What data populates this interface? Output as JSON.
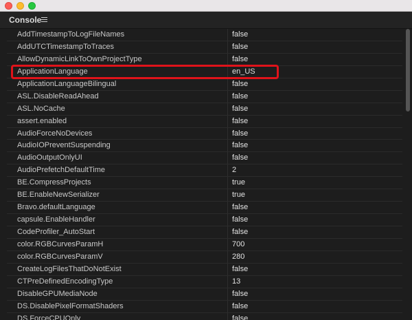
{
  "panel": {
    "title": "Console",
    "menu_icon": "hamburger-menu-icon"
  },
  "rows": [
    {
      "key": "AddTimestampToLogFileNames",
      "value": "false"
    },
    {
      "key": "AddUTCTimestampToTraces",
      "value": "false"
    },
    {
      "key": "AllowDynamicLinkToOwnProjectType",
      "value": "false"
    },
    {
      "key": "ApplicationLanguage",
      "value": "en_US"
    },
    {
      "key": "ApplicationLanguageBilingual",
      "value": "false"
    },
    {
      "key": "ASL.DisableReadAhead",
      "value": "false"
    },
    {
      "key": "ASL.NoCache",
      "value": "false"
    },
    {
      "key": "assert.enabled",
      "value": "false"
    },
    {
      "key": "AudioForceNoDevices",
      "value": "false"
    },
    {
      "key": "AudioIOPreventSuspending",
      "value": "false"
    },
    {
      "key": "AudioOutputOnlyUI",
      "value": "false"
    },
    {
      "key": "AudioPrefetchDefaultTime",
      "value": "2"
    },
    {
      "key": "BE.CompressProjects",
      "value": "true"
    },
    {
      "key": "BE.EnableNewSerializer",
      "value": "true"
    },
    {
      "key": "Bravo.defaultLanguage",
      "value": "false"
    },
    {
      "key": "capsule.EnableHandler",
      "value": "false"
    },
    {
      "key": "CodeProfiler_AutoStart",
      "value": "false"
    },
    {
      "key": "color.RGBCurvesParamH",
      "value": "700"
    },
    {
      "key": "color.RGBCurvesParamV",
      "value": "280"
    },
    {
      "key": "CreateLogFilesThatDoNotExist",
      "value": "false"
    },
    {
      "key": "CTPreDefinedEncodingType",
      "value": "13"
    },
    {
      "key": "DisableGPUMediaNode",
      "value": "false"
    },
    {
      "key": "DS.DisablePixelFormatShaders",
      "value": "false"
    },
    {
      "key": "DS.ForceCPUOnly",
      "value": "false"
    }
  ],
  "highlighted_row": "ApplicationLanguage",
  "colors": {
    "highlight": "#e0131a",
    "background": "#1d1d1d",
    "text": "#c9c9c9"
  }
}
